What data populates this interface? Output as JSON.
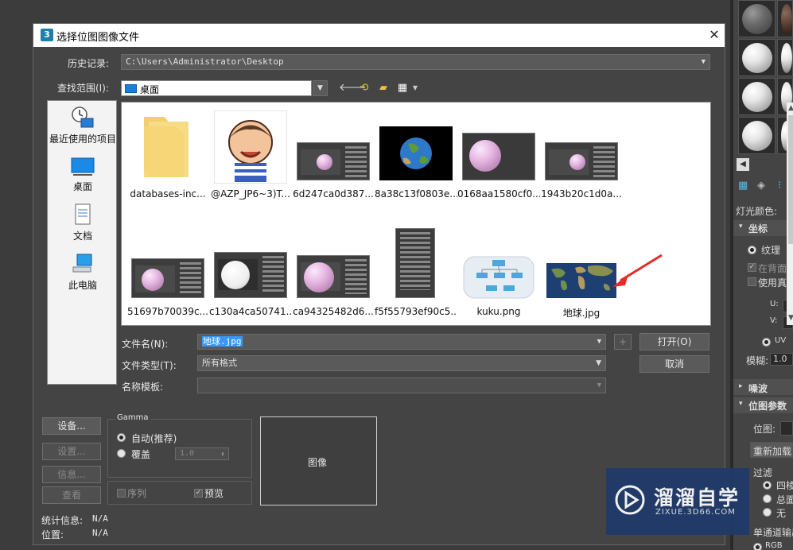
{
  "dialog": {
    "title": "选择位图图像文件",
    "close_label": "✕",
    "history_label": "历史记录:",
    "history_value": "C:\\Users\\Administrator\\Desktop",
    "lookin_label": "查找范围(I):",
    "lookin_value": "桌面",
    "places": [
      "最近使用的项目",
      "桌面",
      "文档",
      "此电脑"
    ],
    "files_row1": [
      "databases-inc...",
      "@AZP_JP6~3)T...",
      "6d247ca0d387...",
      "8a38c13f0803e...",
      "0168aa1580cf0...",
      "1943b20c1d0a..."
    ],
    "files_row2": [
      "51697b70039c...",
      "c130a4ca50741...",
      "ca94325482d6...",
      "f5f55793ef90c5...",
      "kuku.png",
      "地球.jpg"
    ],
    "filename_label": "文件名(N):",
    "filename_value": "地球.jpg",
    "plus_label": "+",
    "open_button": "打开(O)",
    "filetype_label": "文件类型(T):",
    "filetype_value": "所有格式",
    "cancel_button": "取消",
    "template_label": "名称模板:",
    "template_value": "",
    "setup_button": "设备...",
    "settings_button": "设置...",
    "info_button": "信息...",
    "view_button": "查看",
    "gamma_title": "Gamma",
    "gamma_auto": "自动(推荐)",
    "gamma_override": "覆盖",
    "gamma_override_value": "1.0",
    "sequence_label": "序列",
    "preview_label": "预览",
    "image_label": "图像",
    "stats_label": "统计信息:",
    "stats_value": "N/A",
    "location_label": "位置:",
    "location_value": "N/A"
  },
  "right_panel": {
    "light_color_label": "灯光颜色:",
    "coords_section": "坐标",
    "texture_label": "纹理",
    "show_back_label": "在背面显",
    "use_real_label": "使用真实",
    "u_label": "U:",
    "v_label": "V:",
    "uv_label": "UV",
    "blur_label": "模糊:",
    "blur_value": "1.0",
    "noise_section": "噪波",
    "bitmap_params_section": "位图参数",
    "bitmap_label": "位图:",
    "reload_label": "重新加载",
    "filter_label": "过滤",
    "filter_quad": "四棱",
    "filter_total": "总面",
    "filter_none": "无",
    "mono_output_label": "单通道输出",
    "rgb_label": "RGB"
  },
  "watermark": {
    "brand": "溜溜自学",
    "url": "ZIXUE.3D66.COM"
  },
  "colors": {
    "dialog_bg": "#444444",
    "list_bg": "#ffffff",
    "selection": "#3399ff",
    "arrow": "#e52a2a"
  }
}
